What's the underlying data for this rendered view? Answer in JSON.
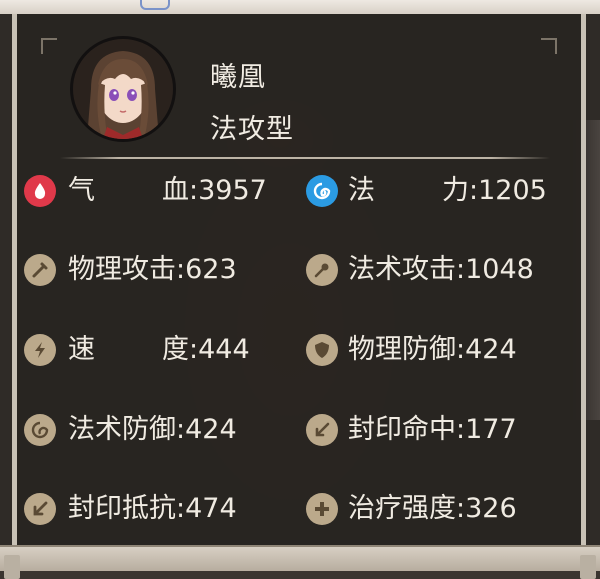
{
  "character": {
    "name": "曦凰",
    "type": "法攻型"
  },
  "stats": [
    {
      "id": "hp",
      "icon": "blood-drop-icon",
      "label": "气",
      "value_text": "血:3957"
    },
    {
      "id": "mp",
      "icon": "mana-swirl-icon",
      "label": "法",
      "value_text": "力:1205"
    },
    {
      "id": "phys_atk",
      "icon": "sword-icon",
      "label": "物理攻击:623"
    },
    {
      "id": "mag_atk",
      "icon": "staff-icon",
      "label": "法术攻击:1048"
    },
    {
      "id": "speed",
      "icon": "lightning-icon",
      "label": "速",
      "value_text": "度:444"
    },
    {
      "id": "phys_def",
      "icon": "shield-icon",
      "label": "物理防御:424"
    },
    {
      "id": "mag_def",
      "icon": "spiral-icon",
      "label": "法术防御:424"
    },
    {
      "id": "seal_hit",
      "icon": "seal-hit-icon",
      "label": "封印命中:177"
    },
    {
      "id": "seal_res",
      "icon": "arrow-down-left-icon",
      "label": "封印抵抗:474"
    },
    {
      "id": "heal",
      "icon": "plus-icon",
      "label": "治疗强度:326"
    }
  ],
  "colors": {
    "panel": "#28251f",
    "text": "#f0ebe2",
    "icon_tan": "#bba98b",
    "icon_red": "#e0394a",
    "icon_blue": "#2b9be3"
  }
}
